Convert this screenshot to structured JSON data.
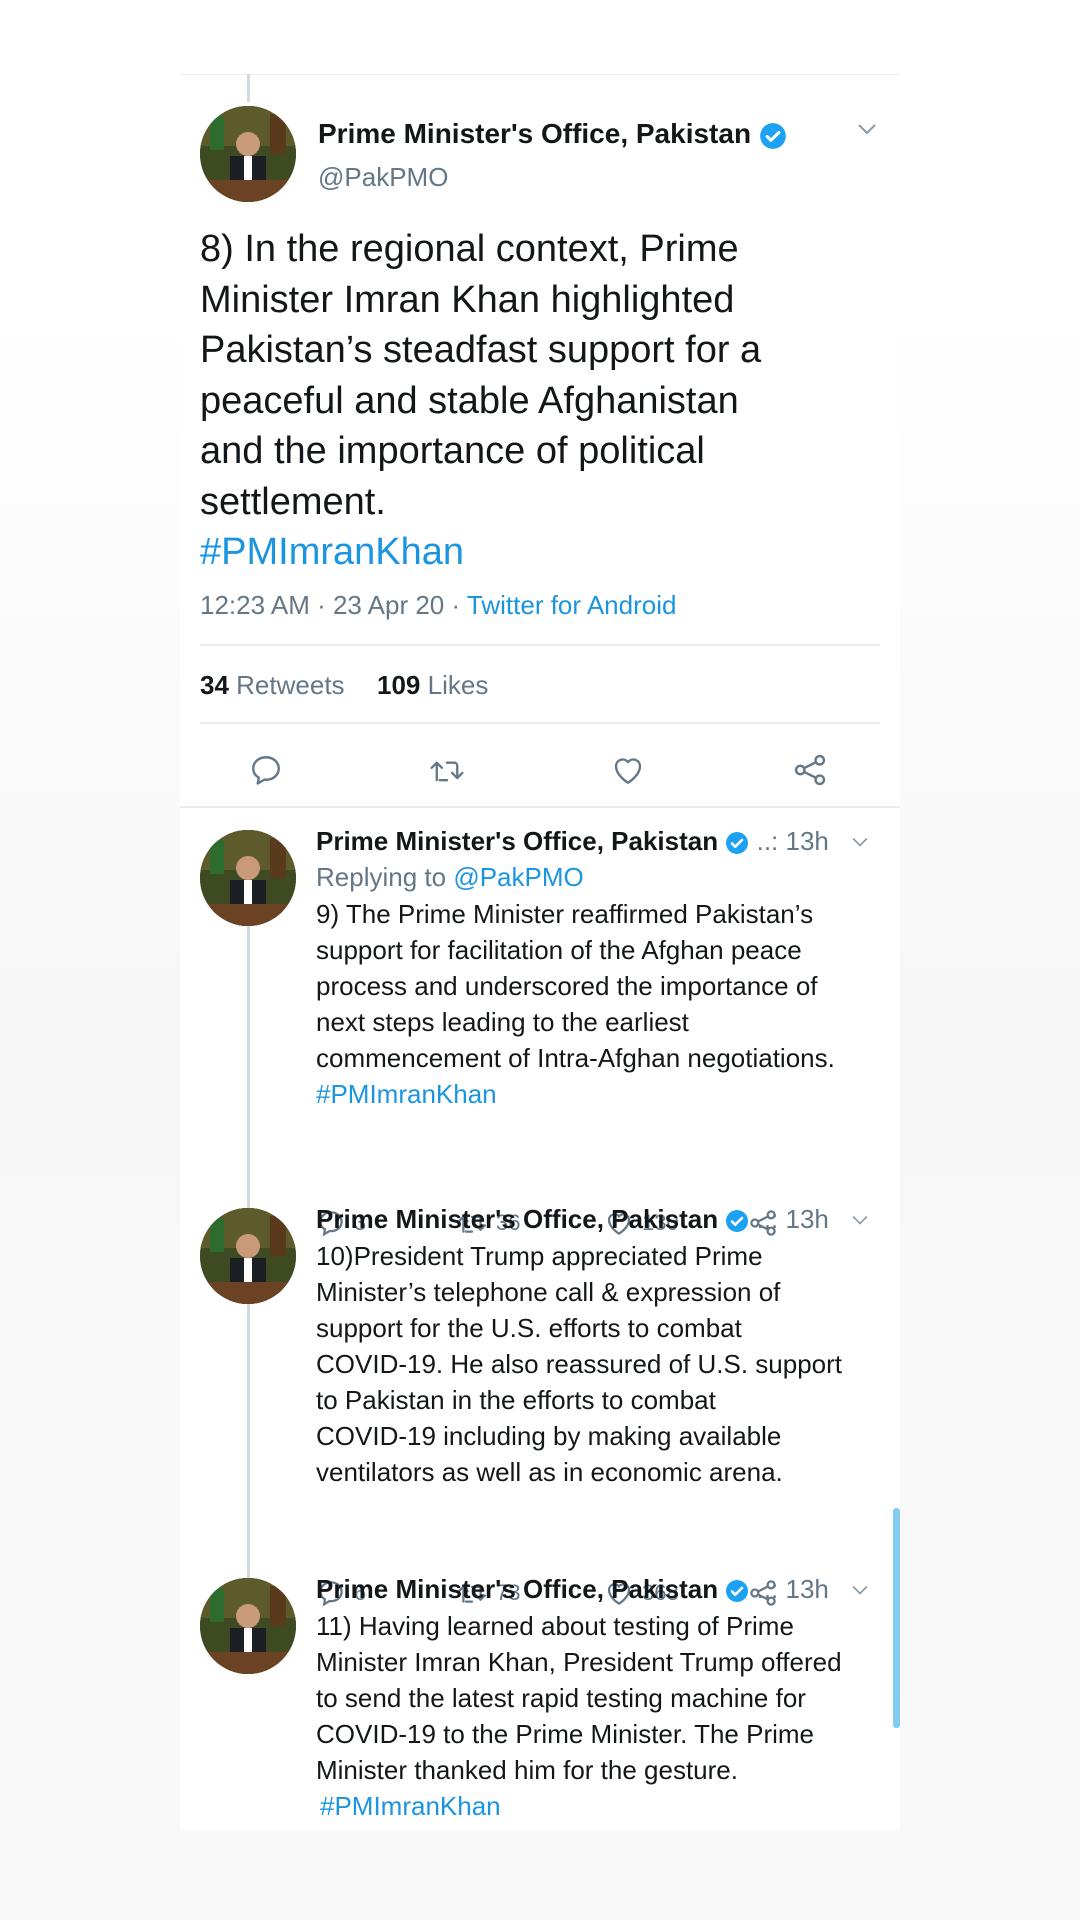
{
  "main_tweet": {
    "name": "Prime Minister's Office, Pakistan",
    "handle": "@PakPMO",
    "text_lines": [
      "8) In the regional context, Prime",
      "Minister Imran Khan highlighted",
      "Pakistan’s steadfast support for a",
      "peaceful and stable Afghanistan",
      "and the importance of political",
      "settlement."
    ],
    "hashtag": "#PMImranKhan",
    "timestamp": "12:23 AM · 23 Apr 20 · ",
    "source": "Twitter for Android",
    "retweets_count": "34",
    "retweets_label": "Retweets",
    "likes_count": "109",
    "likes_label": "Likes"
  },
  "replies": [
    {
      "name": "Prime Minister's Office, Pakistan",
      "time": "..: 13h",
      "replying_prefix": "Replying to ",
      "replying_handle": "@PakPMO",
      "lines": [
        "9) The Prime Minister reaffirmed Pakistan’s",
        "support for facilitation of the Afghan peace",
        "process and underscored the importance of",
        "next steps leading to the earliest",
        "commencement of Intra-Afghan negotiations."
      ],
      "hashtag": "#PMImranKhan",
      "replies": "3",
      "retweets": "36",
      "likes": "130"
    },
    {
      "name": "Prime Minister's Office, Pakistan",
      "time": "..: 13h",
      "lines": [
        "10)President Trump appreciated Prime",
        "Minister’s telephone call & expression of",
        "support for the U.S. efforts to combat",
        "COVID-19. He also reassured of U.S. support",
        "to Pakistan in the efforts to combat",
        "COVID-19 including by making available",
        "ventilators as well as in economic arena."
      ],
      "replies": "6",
      "retweets": "73",
      "likes": "368"
    },
    {
      "name": "Prime Minister's Office, Pakistan",
      "time": "..: 13h",
      "lines": [
        "11) Having learned about testing of Prime",
        "Minister Imran Khan, President Trump offered",
        "to send the latest rapid testing machine for",
        "COVID-19 to the Prime Minister. The Prime",
        "Minister thanked him for the gesture."
      ],
      "hashtag": "#PMImranKhan"
    }
  ],
  "icons": [
    "verified-badge-icon",
    "chevron-down-icon",
    "reply-icon",
    "retweet-icon",
    "like-icon",
    "share-icon"
  ],
  "colors": {
    "link": "#1b95e0",
    "muted": "#657786",
    "text": "#14171a",
    "verified": "#1da1f2"
  }
}
